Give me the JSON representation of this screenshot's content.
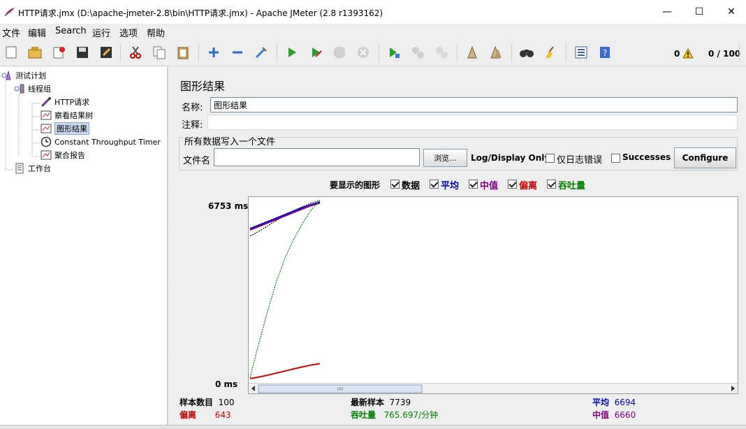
{
  "window": {
    "title": "HTTP请求.jmx (D:\\apache-jmeter-2.8\\bin\\HTTP请求.jmx) - Apache JMeter (2.8 r1393162)",
    "minimize": "—",
    "maximize": "☐",
    "close": "✕"
  },
  "menu": [
    "文件",
    "编辑",
    "Search",
    "运行",
    "选项",
    "帮助"
  ],
  "toolbar": {
    "error_count": "0",
    "thread_count": "0 / 100",
    "icons": [
      "new-icon",
      "open-icon",
      "close-icon",
      "save-icon",
      "save-as-icon",
      "cut-icon",
      "copy-icon",
      "paste-icon",
      "expand-icon",
      "collapse-icon",
      "toggle-icon",
      "start-icon",
      "start-no-pause-icon",
      "stop-icon",
      "shutdown-icon",
      "remote-start-icon",
      "remote-stop-icon",
      "remote-shutdown-icon",
      "clear-icon",
      "clear-all-icon",
      "search-icon",
      "reset-search-icon",
      "function-helper-icon",
      "help-icon"
    ]
  },
  "tree": {
    "nodes": [
      {
        "label": "测试计划",
        "icon": "test-plan-icon"
      },
      {
        "label": "线程组",
        "icon": "thread-group-icon"
      },
      {
        "label": "HTTP请求",
        "icon": "sampler-icon"
      },
      {
        "label": "察看结果树",
        "icon": "listener-icon"
      },
      {
        "label": "图形结果",
        "icon": "listener-icon"
      },
      {
        "label": "Constant Throughput Timer",
        "icon": "timer-icon"
      },
      {
        "label": "聚合报告",
        "icon": "listener-icon"
      },
      {
        "label": "工作台",
        "icon": "workbench-icon"
      }
    ]
  },
  "panel": {
    "title": "图形结果",
    "name_label": "名称:",
    "name_value": "图形结果",
    "comment_label": "注释:",
    "comment_value": "",
    "file_group_title": "所有数据写入一个文件",
    "filename_label": "文件名",
    "filename_value": "",
    "browse_button": "浏览...",
    "log_display_label": "Log/Display Only:",
    "errors_only_label": "仅日志错误",
    "successes_label": "Successes",
    "configure_button": "Configure"
  },
  "graph_options": {
    "label": "要显示的图形",
    "items": [
      {
        "label": "数据",
        "checked": true,
        "color": "#000000"
      },
      {
        "label": "平均",
        "checked": true,
        "color": "#0000cc"
      },
      {
        "label": "中值",
        "checked": true,
        "color": "#800080"
      },
      {
        "label": "偏离",
        "checked": true,
        "color": "#cc0000"
      },
      {
        "label": "吞吐量",
        "checked": true,
        "color": "#008000"
      }
    ]
  },
  "chart_data": {
    "type": "line",
    "y_max_label": "6753 ms",
    "y_min_label": "0 ms",
    "ylim": [
      0,
      6753
    ],
    "x_samples": 100,
    "series": [
      {
        "name": "数据",
        "color": "#000000",
        "values": [
          5420,
          5600,
          5800,
          6000,
          6200,
          6380,
          6520,
          6660,
          6753
        ]
      },
      {
        "name": "平均",
        "color": "#0000cc",
        "values": [
          5700,
          5850,
          6000,
          6150,
          6300,
          6450,
          6580,
          6694
        ]
      },
      {
        "name": "中值",
        "color": "#800080",
        "values": [
          5650,
          5800,
          5950,
          6100,
          6250,
          6400,
          6550,
          6660
        ]
      },
      {
        "name": "偏离",
        "color": "#cc0000",
        "values": [
          80,
          150,
          230,
          320,
          410,
          500,
          580,
          643
        ]
      },
      {
        "name": "吞吐量",
        "color": "#008000",
        "values": [
          120,
          1400,
          2600,
          3700,
          4600,
          5300,
          5900,
          6400,
          6753
        ]
      }
    ]
  },
  "stats": {
    "samples_label": "样本数目",
    "samples_value": "100",
    "latest_label": "最新样本",
    "latest_value": "7739",
    "average_label": "平均",
    "average_value": "6694",
    "deviation_label": "偏离",
    "deviation_value": "643",
    "throughput_label": "吞吐量",
    "throughput_value": "765.697/分钟",
    "median_label": "中值",
    "median_value": "6660"
  }
}
